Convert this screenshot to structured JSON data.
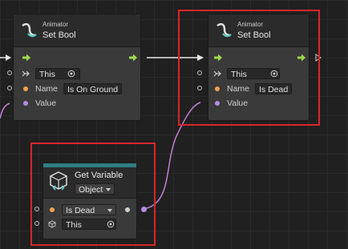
{
  "nodes": {
    "left": {
      "kicker": "Animator",
      "title": "Set Bool",
      "target": "This",
      "name_label": "Name",
      "name_value": "Is On Ground",
      "value_label": "Value"
    },
    "right": {
      "kicker": "Animator",
      "title": "Set Bool",
      "target": "This",
      "name_label": "Name",
      "name_value": "Is Dead",
      "value_label": "Value"
    },
    "get_variable": {
      "title": "Get Variable",
      "kind": "Object",
      "variable": "Is Dead",
      "target": "This"
    }
  },
  "colors": {
    "flow_arrow": "#9bd94b",
    "value_wire": "#c280d6",
    "highlight": "#d8262a",
    "variable_header": "#2f7f84",
    "string_pin": "#f0a050",
    "bool_pin": "#b58ce0"
  },
  "icons": {
    "animator": "animator-curve-icon",
    "variable": "cube-variable-icon",
    "flow": "flow-arrow-icon",
    "target": "target-icon"
  }
}
